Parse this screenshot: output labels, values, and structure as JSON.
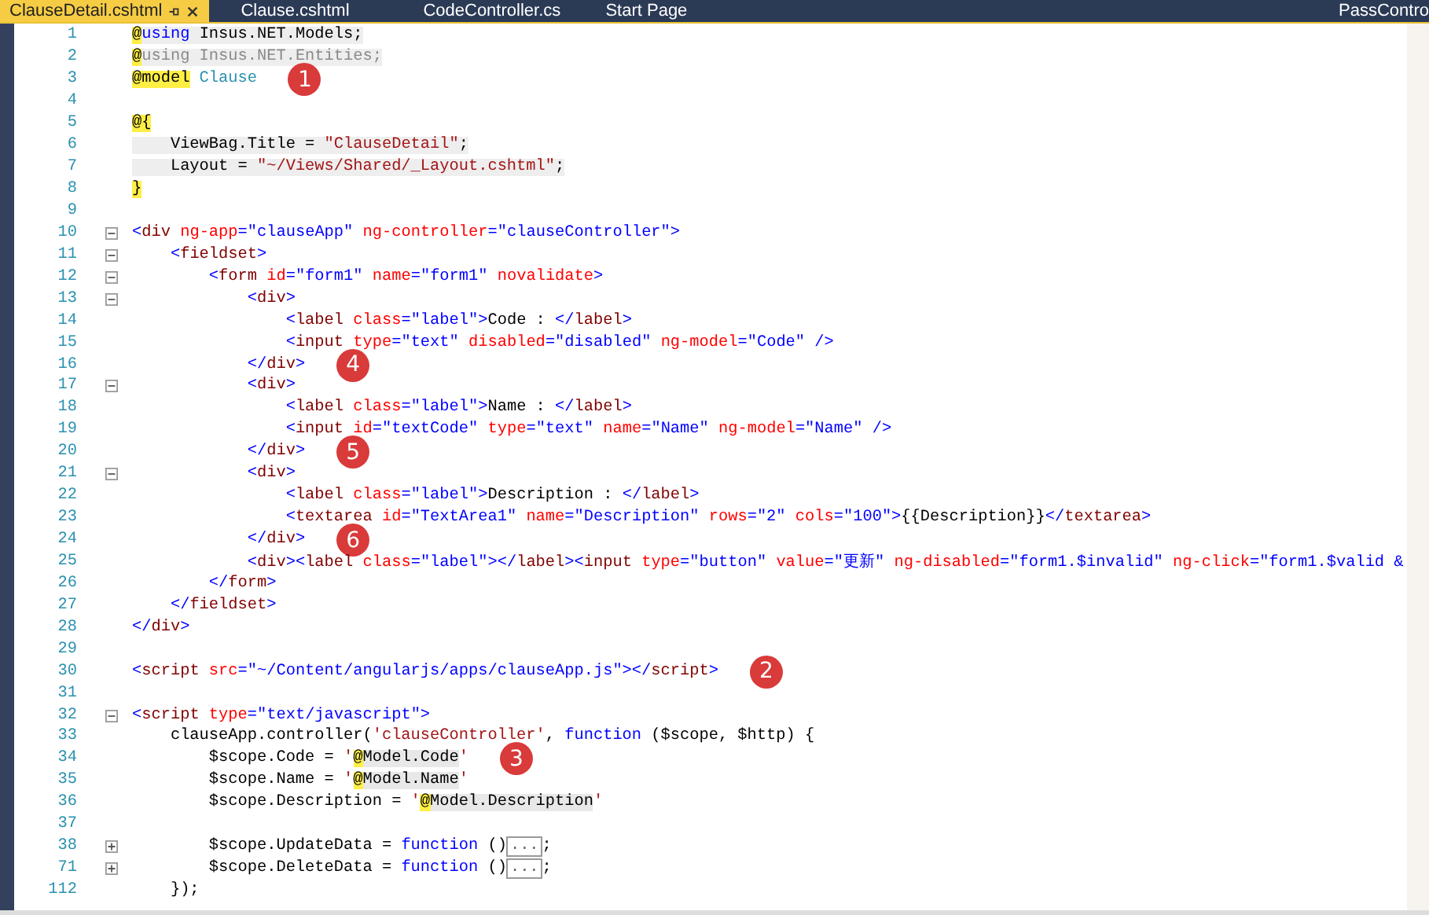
{
  "tabs": [
    {
      "label": "ClauseDetail.cshtml",
      "selected": true
    },
    {
      "label": "Clause.cshtml",
      "selected": false
    },
    {
      "label": "CodeController.cs",
      "selected": false
    },
    {
      "label": "Start Page",
      "selected": false
    }
  ],
  "overflow_tab": {
    "label": "PassContro"
  },
  "lines": [
    {
      "num": "1",
      "shaded": true,
      "tokens": [
        {
          "kind": "at",
          "text": "@"
        },
        {
          "kind": "kw",
          "text": "using"
        },
        {
          "kind": "p",
          "text": " Insus.NET.Models;"
        }
      ]
    },
    {
      "num": "2",
      "shaded": true,
      "tokens": [
        {
          "kind": "at",
          "text": "@"
        },
        {
          "kind": "dim",
          "text": "using Insus.NET.Entities;"
        }
      ]
    },
    {
      "num": "3",
      "callout": "1",
      "shaded": false,
      "tokens": [
        {
          "kind": "at",
          "text": "@model"
        },
        {
          "kind": "type",
          "text": " Clause"
        }
      ]
    },
    {
      "num": "4"
    },
    {
      "num": "5",
      "tokens": [
        {
          "kind": "at",
          "text": "@{"
        }
      ]
    },
    {
      "num": "6",
      "shaded": true,
      "tokens": [
        {
          "kind": "p",
          "text": "    ViewBag.Title = "
        },
        {
          "kind": "cstr",
          "text": "\"ClauseDetail\""
        },
        {
          "kind": "p",
          "text": ";"
        }
      ]
    },
    {
      "num": "7",
      "shaded": true,
      "tokens": [
        {
          "kind": "p",
          "text": "    Layout = "
        },
        {
          "kind": "cstr",
          "text": "\"~/Views/Shared/_Layout.cshtml\""
        },
        {
          "kind": "p",
          "text": ";"
        }
      ]
    },
    {
      "num": "8",
      "tokens": [
        {
          "kind": "at",
          "text": "}"
        }
      ]
    },
    {
      "num": "9"
    },
    {
      "num": "10",
      "collapsed": false,
      "tokens": [
        {
          "kind": "v",
          "text": "<"
        },
        {
          "kind": "tag",
          "text": "div "
        },
        {
          "kind": "attr",
          "text": "ng-app"
        },
        {
          "kind": "v",
          "text": "=\"clauseApp\" "
        },
        {
          "kind": "attr",
          "text": "ng-controller"
        },
        {
          "kind": "v",
          "text": "=\"clauseController\">"
        }
      ]
    },
    {
      "num": "11",
      "collapsed": false,
      "tokens": [
        {
          "kind": "v",
          "text": "    <"
        },
        {
          "kind": "tag",
          "text": "fieldset"
        },
        {
          "kind": "v",
          "text": ">"
        }
      ]
    },
    {
      "num": "12",
      "collapsed": false,
      "tokens": [
        {
          "kind": "v",
          "text": "        <"
        },
        {
          "kind": "tag",
          "text": "form "
        },
        {
          "kind": "attr",
          "text": "id"
        },
        {
          "kind": "v",
          "text": "=\"form1\" "
        },
        {
          "kind": "attr",
          "text": "name"
        },
        {
          "kind": "v",
          "text": "=\"form1\" "
        },
        {
          "kind": "attr",
          "text": "novalidate"
        },
        {
          "kind": "v",
          "text": ">"
        }
      ]
    },
    {
      "num": "13",
      "collapsed": false,
      "tokens": [
        {
          "kind": "v",
          "text": "            <"
        },
        {
          "kind": "tag",
          "text": "div"
        },
        {
          "kind": "v",
          "text": ">"
        }
      ]
    },
    {
      "num": "14",
      "tokens": [
        {
          "kind": "v",
          "text": "                <"
        },
        {
          "kind": "tag",
          "text": "label "
        },
        {
          "kind": "attr",
          "text": "class"
        },
        {
          "kind": "v",
          "text": "=\"label\">"
        },
        {
          "kind": "p",
          "text": "Code : "
        },
        {
          "kind": "v",
          "text": "</"
        },
        {
          "kind": "tag",
          "text": "label"
        },
        {
          "kind": "v",
          "text": ">"
        }
      ]
    },
    {
      "num": "15",
      "tokens": [
        {
          "kind": "v",
          "text": "                <"
        },
        {
          "kind": "tag",
          "text": "input "
        },
        {
          "kind": "attr",
          "text": "type"
        },
        {
          "kind": "v",
          "text": "=\"text\" "
        },
        {
          "kind": "attr",
          "text": "disabled"
        },
        {
          "kind": "v",
          "text": "=\"disabled\" "
        },
        {
          "kind": "attr",
          "text": "ng-model"
        },
        {
          "kind": "v",
          "text": "=\"Code\" />"
        }
      ]
    },
    {
      "num": "16",
      "callout": "4",
      "tokens": [
        {
          "kind": "v",
          "text": "            </"
        },
        {
          "kind": "tag",
          "text": "div"
        },
        {
          "kind": "v",
          "text": ">"
        }
      ]
    },
    {
      "num": "17",
      "collapsed": false,
      "tokens": [
        {
          "kind": "v",
          "text": "            <"
        },
        {
          "kind": "tag",
          "text": "div"
        },
        {
          "kind": "v",
          "text": ">"
        }
      ]
    },
    {
      "num": "18",
      "tokens": [
        {
          "kind": "v",
          "text": "                <"
        },
        {
          "kind": "tag",
          "text": "label "
        },
        {
          "kind": "attr",
          "text": "class"
        },
        {
          "kind": "v",
          "text": "=\"label\">"
        },
        {
          "kind": "p",
          "text": "Name : "
        },
        {
          "kind": "v",
          "text": "</"
        },
        {
          "kind": "tag",
          "text": "label"
        },
        {
          "kind": "v",
          "text": ">"
        }
      ]
    },
    {
      "num": "19",
      "tokens": [
        {
          "kind": "v",
          "text": "                <"
        },
        {
          "kind": "tag",
          "text": "input "
        },
        {
          "kind": "attr",
          "text": "id"
        },
        {
          "kind": "v",
          "text": "=\"textCode\" "
        },
        {
          "kind": "attr",
          "text": "type"
        },
        {
          "kind": "v",
          "text": "=\"text\" "
        },
        {
          "kind": "attr",
          "text": "name"
        },
        {
          "kind": "v",
          "text": "=\"Name\" "
        },
        {
          "kind": "attr",
          "text": "ng-model"
        },
        {
          "kind": "v",
          "text": "=\"Name\" />"
        }
      ]
    },
    {
      "num": "20",
      "callout": "5",
      "tokens": [
        {
          "kind": "v",
          "text": "            </"
        },
        {
          "kind": "tag",
          "text": "div"
        },
        {
          "kind": "v",
          "text": ">"
        }
      ]
    },
    {
      "num": "21",
      "collapsed": false,
      "tokens": [
        {
          "kind": "v",
          "text": "            <"
        },
        {
          "kind": "tag",
          "text": "div"
        },
        {
          "kind": "v",
          "text": ">"
        }
      ]
    },
    {
      "num": "22",
      "tokens": [
        {
          "kind": "v",
          "text": "                <"
        },
        {
          "kind": "tag",
          "text": "label "
        },
        {
          "kind": "attr",
          "text": "class"
        },
        {
          "kind": "v",
          "text": "=\"label\">"
        },
        {
          "kind": "p",
          "text": "Description : "
        },
        {
          "kind": "v",
          "text": "</"
        },
        {
          "kind": "tag",
          "text": "label"
        },
        {
          "kind": "v",
          "text": ">"
        }
      ]
    },
    {
      "num": "23",
      "tokens": [
        {
          "kind": "v",
          "text": "                <"
        },
        {
          "kind": "tag",
          "text": "textarea "
        },
        {
          "kind": "attr",
          "text": "id"
        },
        {
          "kind": "v",
          "text": "=\"TextArea1\" "
        },
        {
          "kind": "attr",
          "text": "name"
        },
        {
          "kind": "v",
          "text": "=\"Description\" "
        },
        {
          "kind": "attr",
          "text": "rows"
        },
        {
          "kind": "v",
          "text": "=\"2\" "
        },
        {
          "kind": "attr",
          "text": "cols"
        },
        {
          "kind": "v",
          "text": "=\"100\">"
        },
        {
          "kind": "p",
          "text": "{{Description}}"
        },
        {
          "kind": "v",
          "text": "</"
        },
        {
          "kind": "tag",
          "text": "textarea"
        },
        {
          "kind": "v",
          "text": ">"
        }
      ]
    },
    {
      "num": "24",
      "callout": "6",
      "tokens": [
        {
          "kind": "v",
          "text": "            </"
        },
        {
          "kind": "tag",
          "text": "div"
        },
        {
          "kind": "v",
          "text": ">"
        }
      ]
    },
    {
      "num": "25",
      "tokens": [
        {
          "kind": "v",
          "text": "            <"
        },
        {
          "kind": "tag",
          "text": "div"
        },
        {
          "kind": "v",
          "text": "><"
        },
        {
          "kind": "tag",
          "text": "label "
        },
        {
          "kind": "attr",
          "text": "class"
        },
        {
          "kind": "v",
          "text": "=\"label\"></"
        },
        {
          "kind": "tag",
          "text": "label"
        },
        {
          "kind": "v",
          "text": "><"
        },
        {
          "kind": "tag",
          "text": "input "
        },
        {
          "kind": "attr",
          "text": "type"
        },
        {
          "kind": "v",
          "text": "=\"button\" "
        },
        {
          "kind": "attr",
          "text": "value"
        },
        {
          "kind": "v",
          "text": "=\"更新\" "
        },
        {
          "kind": "attr",
          "text": "ng-disabled"
        },
        {
          "kind": "v",
          "text": "=\"form1.$invalid\" "
        },
        {
          "kind": "attr",
          "text": "ng-click"
        },
        {
          "kind": "v",
          "text": "=\"form1.$valid &"
        }
      ]
    },
    {
      "num": "26",
      "tokens": [
        {
          "kind": "v",
          "text": "        </"
        },
        {
          "kind": "tag",
          "text": "form"
        },
        {
          "kind": "v",
          "text": ">"
        }
      ]
    },
    {
      "num": "27",
      "tokens": [
        {
          "kind": "v",
          "text": "    </"
        },
        {
          "kind": "tag",
          "text": "fieldset"
        },
        {
          "kind": "v",
          "text": ">"
        }
      ]
    },
    {
      "num": "28",
      "tokens": [
        {
          "kind": "v",
          "text": "</"
        },
        {
          "kind": "tag",
          "text": "div"
        },
        {
          "kind": "v",
          "text": ">"
        }
      ]
    },
    {
      "num": "29"
    },
    {
      "num": "30",
      "callout": "2",
      "tokens": [
        {
          "kind": "v",
          "text": "<"
        },
        {
          "kind": "tag",
          "text": "script "
        },
        {
          "kind": "attr",
          "text": "src"
        },
        {
          "kind": "v",
          "text": "=\"~/Content/angularjs/apps/clauseApp.js\"></"
        },
        {
          "kind": "tag",
          "text": "script"
        },
        {
          "kind": "v",
          "text": ">"
        }
      ]
    },
    {
      "num": "31"
    },
    {
      "num": "32",
      "collapsed": false,
      "tokens": [
        {
          "kind": "v",
          "text": "<"
        },
        {
          "kind": "tag",
          "text": "script "
        },
        {
          "kind": "attr",
          "text": "type"
        },
        {
          "kind": "v",
          "text": "=\"text/javascript\">"
        }
      ]
    },
    {
      "num": "33",
      "tokens": [
        {
          "kind": "p",
          "text": "    clauseApp.controller("
        },
        {
          "kind": "cstr",
          "text": "'clauseController'"
        },
        {
          "kind": "p",
          "text": ", "
        },
        {
          "kind": "kw",
          "text": "function"
        },
        {
          "kind": "p",
          "text": " ($scope, $http) {"
        }
      ]
    },
    {
      "num": "34",
      "callout": "3",
      "tokens": [
        {
          "kind": "p",
          "text": "        $scope.Code = "
        },
        {
          "kind": "cstr",
          "text": "'"
        },
        {
          "kind": "at",
          "text": "@"
        },
        {
          "kind": "hl",
          "text": "Model.Code"
        },
        {
          "kind": "cstr",
          "text": "'"
        }
      ]
    },
    {
      "num": "35",
      "tokens": [
        {
          "kind": "p",
          "text": "        $scope.Name = "
        },
        {
          "kind": "cstr",
          "text": "'"
        },
        {
          "kind": "at",
          "text": "@"
        },
        {
          "kind": "hl",
          "text": "Model.Name"
        },
        {
          "kind": "cstr",
          "text": "'"
        }
      ]
    },
    {
      "num": "36",
      "tokens": [
        {
          "kind": "p",
          "text": "        $scope.Description = "
        },
        {
          "kind": "cstr",
          "text": "'"
        },
        {
          "kind": "at",
          "text": "@"
        },
        {
          "kind": "hl",
          "text": "Model.Description"
        },
        {
          "kind": "cstr",
          "text": "'"
        }
      ]
    },
    {
      "num": "37"
    },
    {
      "num": "38",
      "collapsed": true,
      "tokens": [
        {
          "kind": "p",
          "text": "        $scope.UpdateData = "
        },
        {
          "kind": "kw",
          "text": "function"
        },
        {
          "kind": "p",
          "text": " ()"
        },
        {
          "kind": "coll",
          "text": "..."
        },
        {
          "kind": "p",
          "text": ";"
        }
      ]
    },
    {
      "num": "71",
      "collapsed": true,
      "tokens": [
        {
          "kind": "p",
          "text": "        $scope.DeleteData = "
        },
        {
          "kind": "kw",
          "text": "function"
        },
        {
          "kind": "p",
          "text": " ()"
        },
        {
          "kind": "coll",
          "text": "..."
        },
        {
          "kind": "p",
          "text": ";"
        }
      ]
    },
    {
      "num": "112",
      "tokens": [
        {
          "kind": "p",
          "text": "    });"
        }
      ]
    }
  ]
}
